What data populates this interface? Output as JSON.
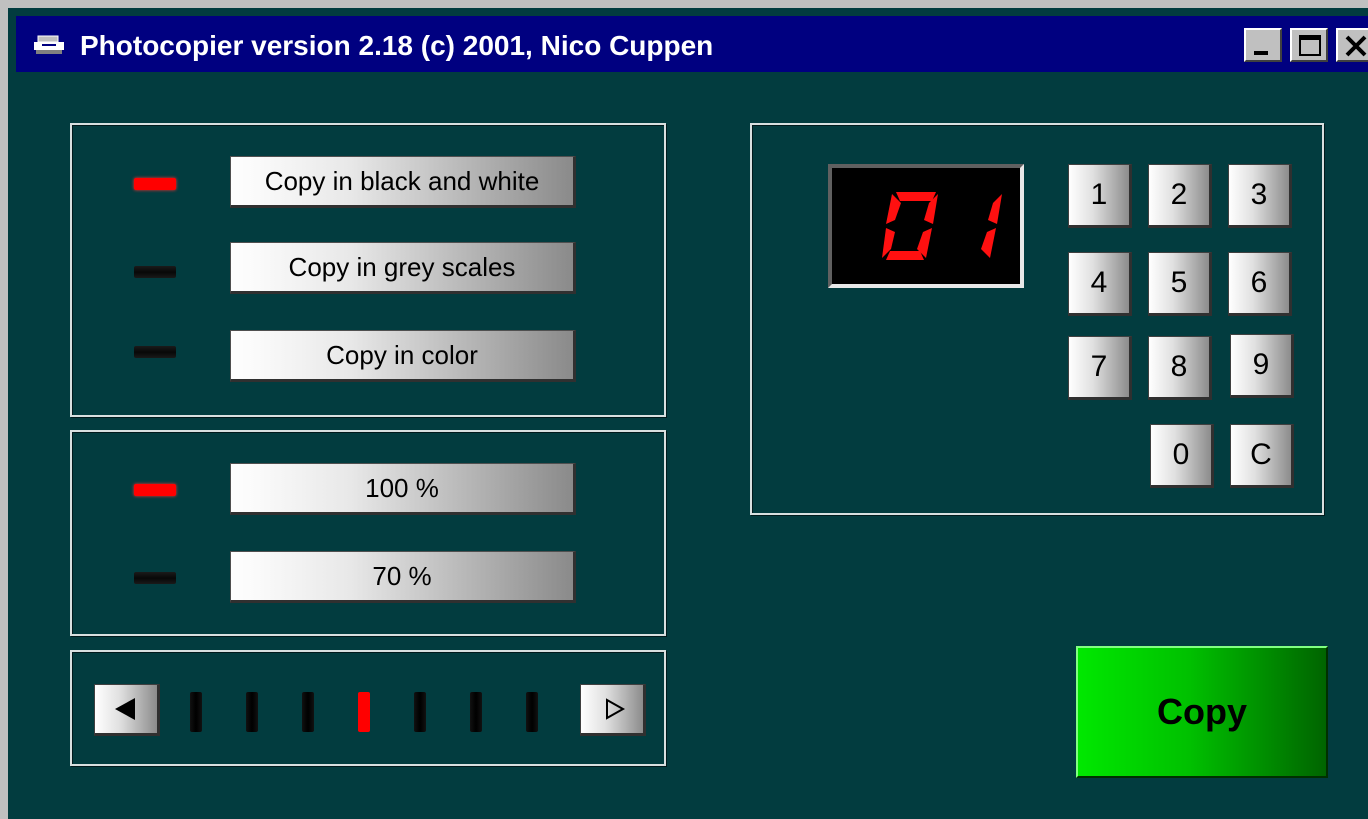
{
  "window": {
    "title": "Photocopier version 2.18  (c) 2001, Nico Cuppen",
    "icon": "photocopier-icon"
  },
  "color_mode": {
    "options": [
      {
        "label": "Copy in black and white",
        "selected": true
      },
      {
        "label": "Copy in grey scales",
        "selected": false
      },
      {
        "label": "Copy in color",
        "selected": false
      }
    ]
  },
  "scale": {
    "options": [
      {
        "label": "100 %",
        "selected": true
      },
      {
        "label": "70 %",
        "selected": false
      }
    ]
  },
  "darkness": {
    "levels": 7,
    "selected_level": 4
  },
  "copies": {
    "display": "01",
    "keys": [
      "1",
      "2",
      "3",
      "4",
      "5",
      "6",
      "7",
      "8",
      "9",
      "0",
      "C"
    ]
  },
  "copy_button": {
    "label": "Copy"
  },
  "colors": {
    "background": "#023c3f",
    "led_on": "#ff0000",
    "copy_button": "#00c000",
    "titlebar": "#000080"
  }
}
